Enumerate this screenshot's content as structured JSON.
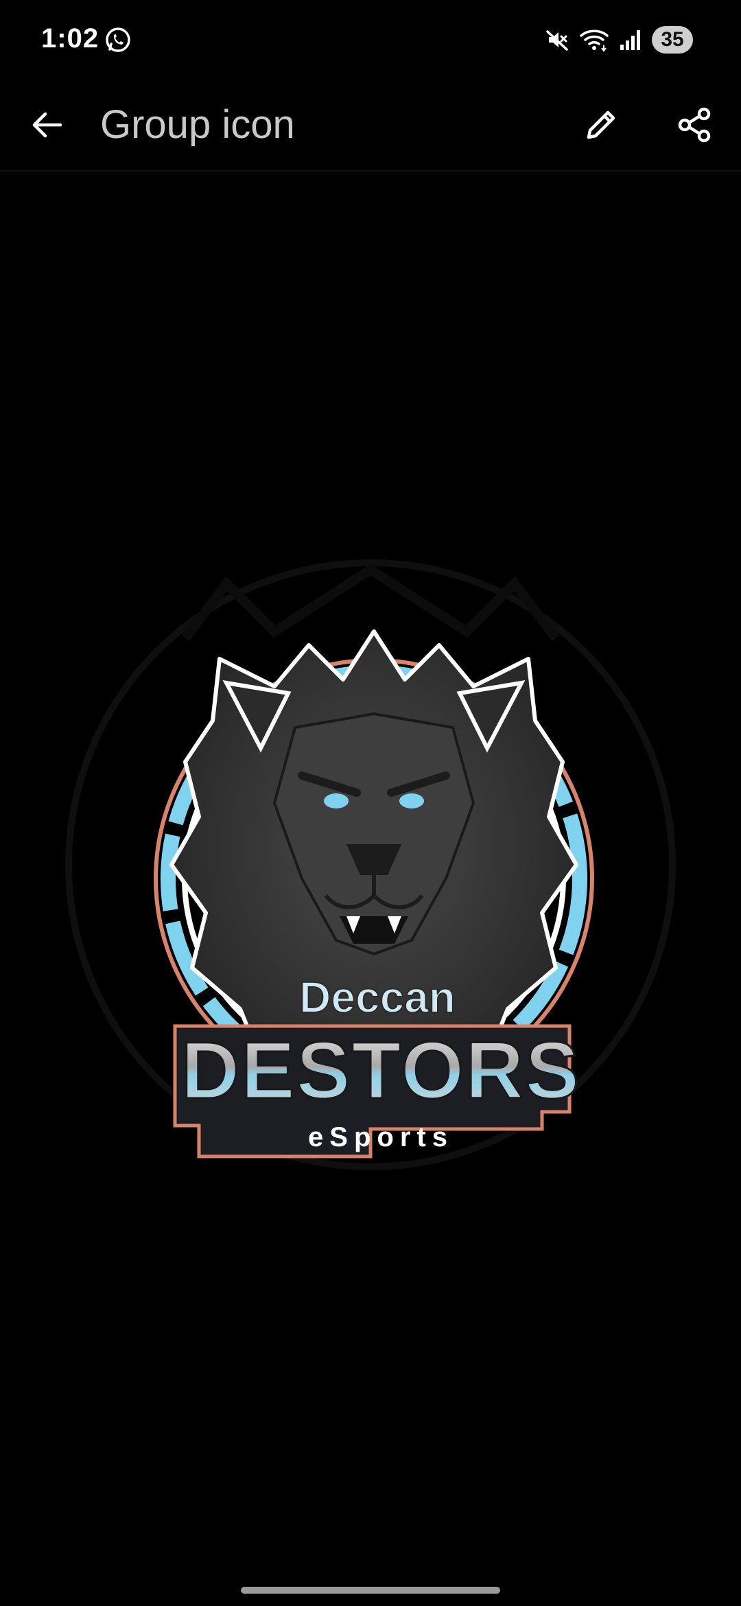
{
  "status_bar": {
    "time": "1:02",
    "battery_level": "35",
    "icons": [
      "whatsapp-icon",
      "mute-icon",
      "wifi-icon",
      "signal-icon"
    ]
  },
  "app_bar": {
    "title": "Group icon",
    "back_icon": "arrow-back-icon",
    "edit_icon": "pencil-icon",
    "share_icon": "share-icon"
  },
  "image": {
    "logo_line1": "Deccan",
    "logo_line2": "DESTORS",
    "logo_line3": "eSports"
  },
  "colors": {
    "background": "#000000",
    "accent_blue": "#7fd3ee",
    "ring_orange": "#d9846a",
    "lion_gray": "#3e3e3e"
  }
}
